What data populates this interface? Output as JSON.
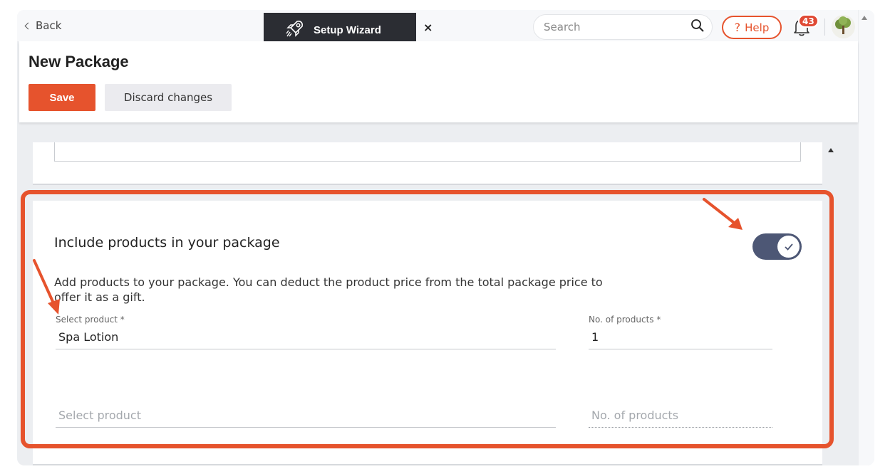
{
  "topbar": {
    "back_label": "Back",
    "wizard_label": "Setup Wizard",
    "wizard_close": "×",
    "search_placeholder": "Search",
    "help_label": "Help",
    "help_glyph": "?",
    "notification_count": "43"
  },
  "header": {
    "title": "New Package",
    "save_label": "Save",
    "discard_label": "Discard changes"
  },
  "section": {
    "title": "Include products in your package",
    "toggle_on": true,
    "description": "Add products to your package. You can deduct the product price from the total package price to offer it as a gift.",
    "product_label": "Select product *",
    "product_value": "Spa Lotion",
    "count_label": "No. of products *",
    "count_value": "1",
    "product_placeholder": "Select product",
    "count_placeholder": "No. of products"
  },
  "colors": {
    "accent": "#e6532d",
    "toggle": "#4d5775",
    "dark_pill": "#2b2d33"
  }
}
